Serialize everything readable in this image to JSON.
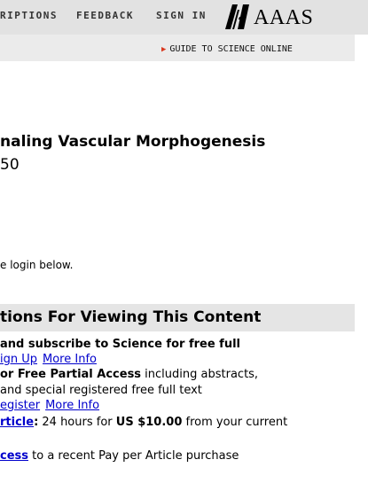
{
  "header": {
    "nav": [
      "RIPTIONS",
      "FEEDBACK",
      "SIGN IN"
    ],
    "logo_text": "AAAS"
  },
  "subheader": {
    "guide_link": "GUIDE TO SCIENCE ONLINE"
  },
  "article": {
    "title": "naling Vascular Morphogenesis",
    "subtitle": "50"
  },
  "login": {
    "text": "e login below."
  },
  "options": {
    "heading": "tions For Viewing This Content",
    "line1": "and subscribe to Science for free full",
    "line2": {
      "sign_up": "ign Up",
      "more_info": "More Info"
    },
    "line3": {
      "bold": "or Free Partial Access",
      "rest": " including abstracts,"
    },
    "line4": " and special registered free full text",
    "line5": {
      "register": "egister",
      "more_info": "More Info"
    },
    "line6": {
      "link": "rticle",
      "colon": ":",
      "text_a": " 24 hours for ",
      "price": "US $10.00",
      "text_b": " from your current"
    },
    "line7": {
      "link": "cess",
      "text": " to a recent Pay per Article purchase"
    }
  },
  "colors": {
    "link": "#0000cc",
    "arrow": "#d9381e",
    "topbar": "#e2e2e2"
  }
}
